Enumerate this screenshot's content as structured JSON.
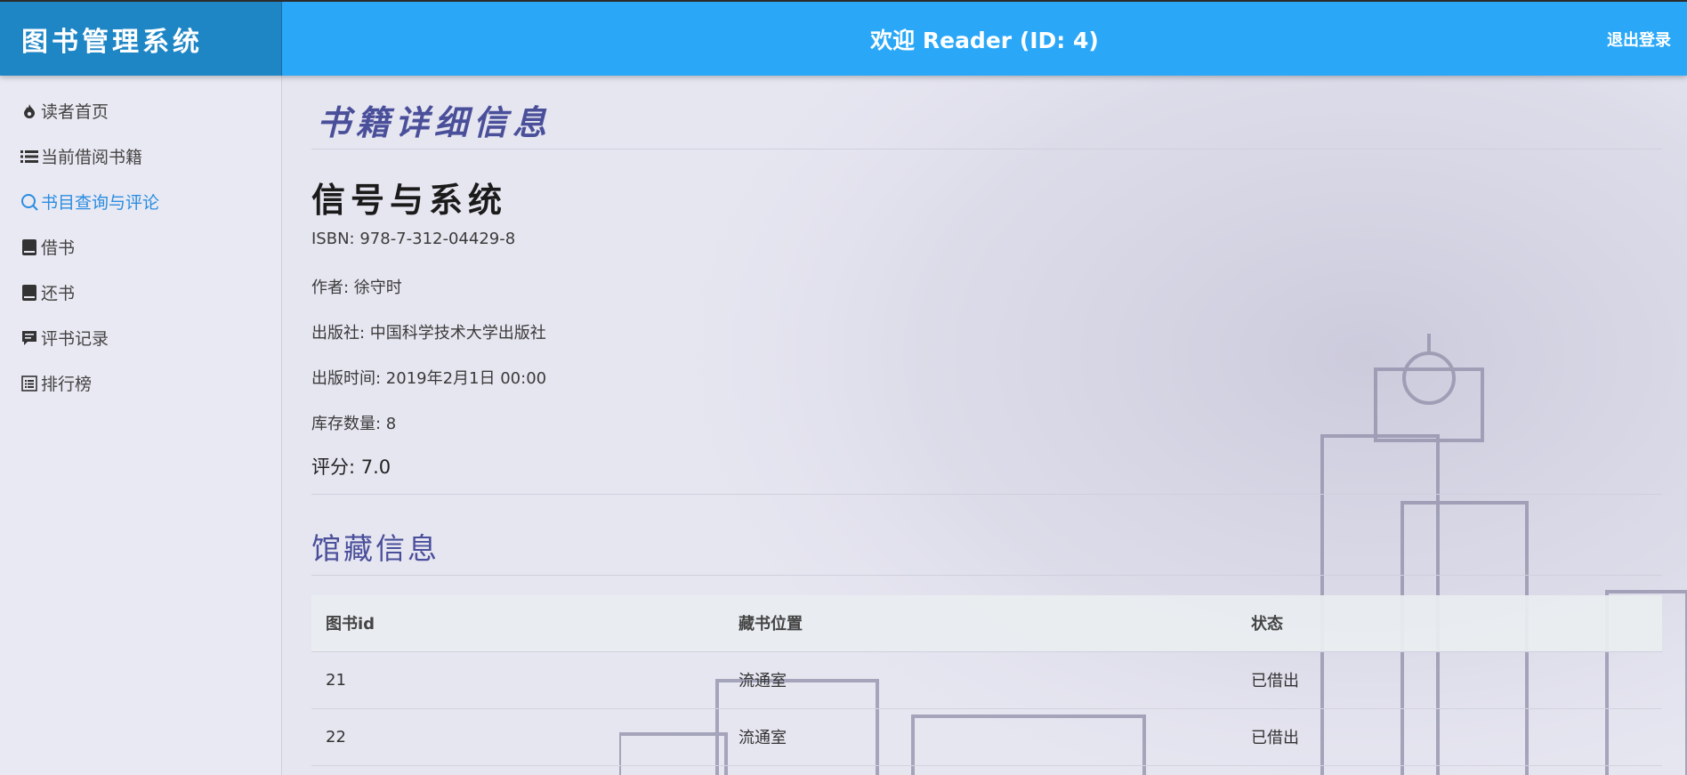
{
  "header": {
    "app_title": "图书管理系统",
    "welcome": "欢迎 Reader (ID: 4)",
    "logout": "退出登录"
  },
  "sidebar": {
    "items": [
      {
        "label": "读者首页",
        "icon": "fire-icon"
      },
      {
        "label": "当前借阅书籍",
        "icon": "list-icon"
      },
      {
        "label": "书目查询与评论",
        "icon": "search-icon",
        "active": true
      },
      {
        "label": "借书",
        "icon": "book-icon"
      },
      {
        "label": "还书",
        "icon": "book-icon"
      },
      {
        "label": "评书记录",
        "icon": "comment-icon"
      },
      {
        "label": "排行榜",
        "icon": "ranking-list-icon"
      }
    ]
  },
  "main": {
    "page_title": "书籍详细信息",
    "book": {
      "title": "信号与系统",
      "isbn": "ISBN: 978-7-312-04429-8",
      "author": "作者: 徐守时",
      "publisher": "出版社: 中国科学技术大学出版社",
      "publish_time": "出版时间: 2019年2月1日 00:00",
      "stock": "库存数量: 8",
      "rating": "评分: 7.0"
    },
    "holdings_title": "馆藏信息",
    "table": {
      "headers": [
        "图书id",
        "藏书位置",
        "状态"
      ],
      "rows": [
        [
          "21",
          "流通室",
          "已借出"
        ],
        [
          "22",
          "流通室",
          "已借出"
        ]
      ]
    }
  },
  "colors": {
    "header_bar": "#2aa8f7",
    "logo_bg": "#1f86c6",
    "active_nav": "#2b8de0",
    "title_purple": "#4a4f9a"
  }
}
